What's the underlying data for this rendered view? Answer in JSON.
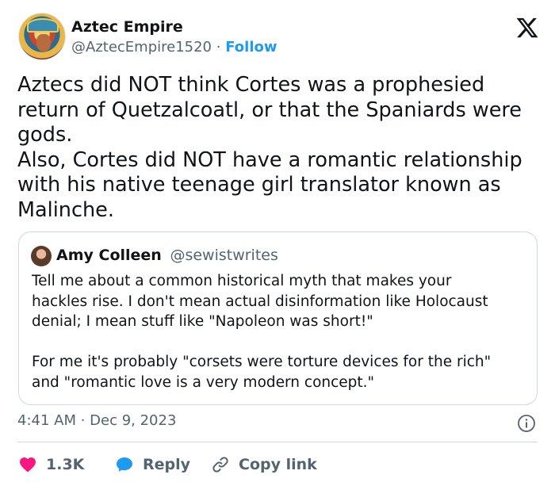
{
  "author": {
    "name": "Aztec Empire",
    "handle": "@AztecEmpire1520",
    "separator": "·",
    "follow_label": "Follow"
  },
  "tweet": {
    "lines": [
      "Aztecs did NOT think Cortes was a prophesied",
      "return of Quetzalcoatl, or that the Spaniards were",
      "gods.",
      "Also, Cortes did NOT have a romantic relationship",
      "with his native teenage girl translator known as",
      "Malinche."
    ]
  },
  "quoted": {
    "name": "Amy Colleen",
    "handle": "@sewistwrites",
    "paragraph1": [
      "Tell me about a common historical myth that makes your",
      "hackles rise. I don't mean actual disinformation like Holocaust",
      "denial; I mean stuff like \"Napoleon was short!\""
    ],
    "paragraph2": [
      "For me it's probably \"corsets were torture devices for the rich\"",
      "and \"romantic love is a very modern concept.\""
    ]
  },
  "timestamp": "4:41 AM · Dec 9, 2023",
  "actions": {
    "likes": "1.3K",
    "reply_label": "Reply",
    "copy_label": "Copy link"
  },
  "colors": {
    "like": "#f91880",
    "reply": "#1d9bf0",
    "link": "#1d9bf0",
    "muted": "#536471"
  }
}
